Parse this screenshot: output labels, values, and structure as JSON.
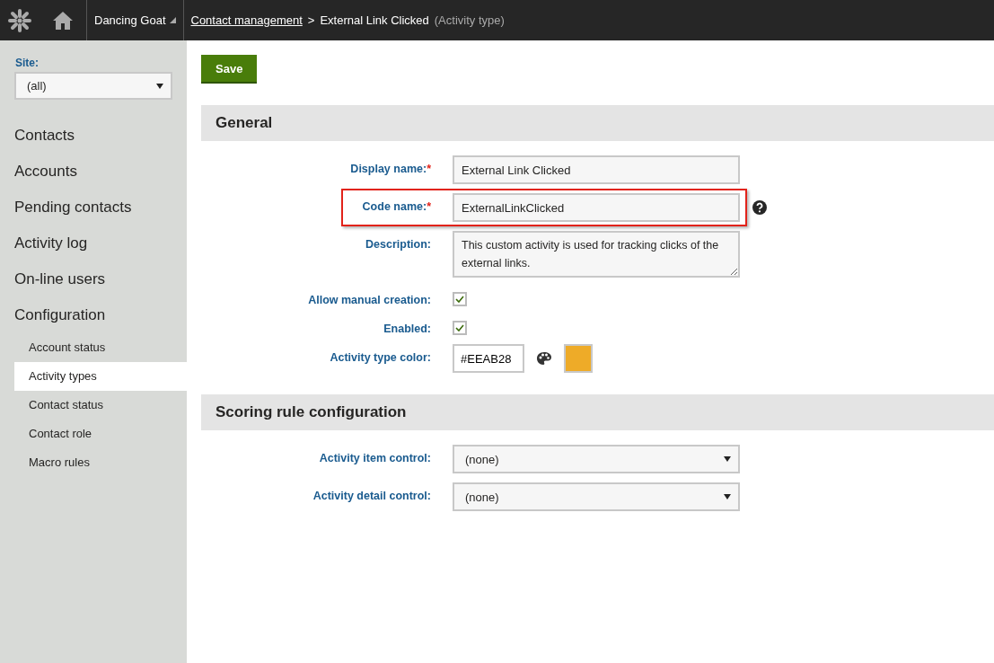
{
  "header": {
    "site_name": "Dancing Goat",
    "breadcrumb_link": "Contact management",
    "breadcrumb_separator": ">",
    "breadcrumb_current": "External Link Clicked",
    "breadcrumb_type": "(Activity type)"
  },
  "sidebar": {
    "site_label": "Site:",
    "site_value": "(all)",
    "items": [
      {
        "label": "Contacts",
        "selected": false
      },
      {
        "label": "Accounts",
        "selected": false
      },
      {
        "label": "Pending contacts",
        "selected": false
      },
      {
        "label": "Activity log",
        "selected": false
      },
      {
        "label": "On-line users",
        "selected": false
      },
      {
        "label": "Configuration",
        "selected": false,
        "children": [
          {
            "label": "Account status",
            "selected": false
          },
          {
            "label": "Activity types",
            "selected": true
          },
          {
            "label": "Contact status",
            "selected": false
          },
          {
            "label": "Contact role",
            "selected": false
          },
          {
            "label": "Macro rules",
            "selected": false
          }
        ]
      }
    ]
  },
  "save_button": "Save",
  "sections": [
    {
      "title": "General",
      "fields": [
        {
          "kind": "text",
          "label": "Display name:",
          "required_mark": "*",
          "highlighted": false,
          "help": false,
          "value": "External Link Clicked"
        },
        {
          "kind": "text",
          "label": "Code name:",
          "required_mark": "*",
          "highlighted": true,
          "help": true,
          "value": "ExternalLinkClicked"
        },
        {
          "kind": "textarea",
          "label": "Description:",
          "highlighted": false,
          "help": false,
          "value": "This custom activity is used for tracking clicks of the external links."
        },
        {
          "kind": "checkbox",
          "label": "Allow manual creation:",
          "highlighted": false,
          "help": false,
          "checked": true
        },
        {
          "kind": "checkbox",
          "label": "Enabled:",
          "highlighted": false,
          "help": false,
          "checked": true
        },
        {
          "kind": "color",
          "label": "Activity type color:",
          "highlighted": false,
          "help": false,
          "value": "#EEAB28",
          "color": "#eeab28"
        }
      ]
    },
    {
      "title": "Scoring rule configuration",
      "fields": [
        {
          "kind": "select",
          "label": "Activity item control:",
          "highlighted": false,
          "help": false,
          "value": "(none)"
        },
        {
          "kind": "select",
          "label": "Activity detail control:",
          "highlighted": false,
          "help": false,
          "value": "(none)"
        }
      ]
    }
  ]
}
